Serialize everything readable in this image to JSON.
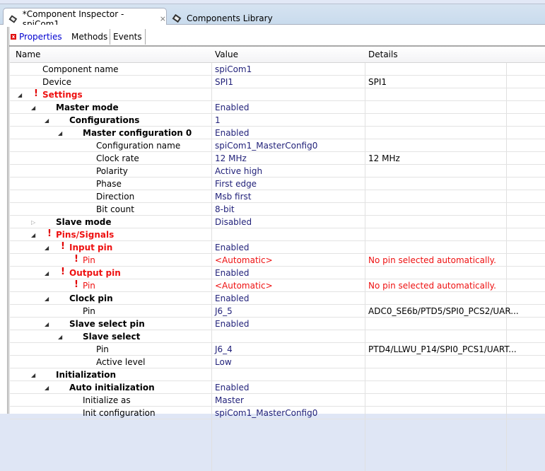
{
  "editor_tabs": [
    {
      "label": "*Component Inspector - spiCom1",
      "icon": "chip-icon",
      "active": true
    },
    {
      "label": "Components Library",
      "icon": "chip-icon",
      "active": false
    }
  ],
  "inspector_tabs": [
    {
      "label": "Properties",
      "active": true,
      "has_error": true
    },
    {
      "label": "Methods"
    },
    {
      "label": "Events"
    }
  ],
  "columns": [
    "Name",
    "Value",
    "Details"
  ],
  "colors": {
    "error": "#ee1111",
    "value": "#22227a",
    "tab_active_text": "#0000d0"
  },
  "rows": [
    {
      "name": "Component name",
      "value": "spiCom1",
      "details": "",
      "depth": 0
    },
    {
      "name": "Device",
      "value": "SPI1",
      "details": "SPI1",
      "depth": 0
    },
    {
      "name": "Settings",
      "value": "",
      "details": "",
      "depth": 0,
      "expand": "open",
      "error": true
    },
    {
      "name": "Master mode",
      "value": "Enabled",
      "details": "",
      "depth": 1,
      "expand": "open"
    },
    {
      "name": "Configurations",
      "value": "1",
      "details": "",
      "depth": 2,
      "expand": "open"
    },
    {
      "name": "Master configuration 0",
      "value": "Enabled",
      "details": "",
      "depth": 3,
      "expand": "open"
    },
    {
      "name": "Configuration name",
      "value": "spiCom1_MasterConfig0",
      "details": "",
      "depth": 4
    },
    {
      "name": "Clock rate",
      "value": "12 MHz",
      "details": "12 MHz",
      "depth": 4
    },
    {
      "name": "Polarity",
      "value": "Active high",
      "details": "",
      "depth": 4
    },
    {
      "name": "Phase",
      "value": "First edge",
      "details": "",
      "depth": 4
    },
    {
      "name": "Direction",
      "value": "Msb first",
      "details": "",
      "depth": 4
    },
    {
      "name": "Bit count",
      "value": "8-bit",
      "details": "",
      "depth": 4
    },
    {
      "name": "Slave mode",
      "value": "Disabled",
      "details": "",
      "depth": 1,
      "expand": "closed"
    },
    {
      "name": "Pins/Signals",
      "value": "",
      "details": "",
      "depth": 1,
      "expand": "open",
      "error": true
    },
    {
      "name": "Input pin",
      "value": "Enabled",
      "details": "",
      "depth": 2,
      "expand": "open",
      "error": true
    },
    {
      "name": "Pin",
      "value": "<Automatic>",
      "details": "No pin selected automatically.",
      "depth": 3,
      "error": true
    },
    {
      "name": "Output pin",
      "value": "Enabled",
      "details": "",
      "depth": 2,
      "expand": "open",
      "error": true
    },
    {
      "name": "Pin",
      "value": "<Automatic>",
      "details": "No pin selected automatically.",
      "depth": 3,
      "error": true
    },
    {
      "name": "Clock pin",
      "value": "Enabled",
      "details": "",
      "depth": 2,
      "expand": "open"
    },
    {
      "name": "Pin",
      "value": "J6_5",
      "details": "ADC0_SE6b/PTD5/SPI0_PCS2/UAR...",
      "depth": 3
    },
    {
      "name": "Slave select pin",
      "value": "Enabled",
      "details": "",
      "depth": 2,
      "expand": "open"
    },
    {
      "name": "Slave select",
      "value": "",
      "details": "",
      "depth": 3,
      "expand": "open"
    },
    {
      "name": "Pin",
      "value": "J6_4",
      "details": "PTD4/LLWU_P14/SPI0_PCS1/UART...",
      "depth": 4
    },
    {
      "name": "Active level",
      "value": "Low",
      "details": "",
      "depth": 4
    },
    {
      "name": "Initialization",
      "value": "",
      "details": "",
      "depth": 1,
      "expand": "open"
    },
    {
      "name": "Auto initialization",
      "value": "Enabled",
      "details": "",
      "depth": 2,
      "expand": "open"
    },
    {
      "name": "Initialize as",
      "value": "Master",
      "details": "",
      "depth": 3
    },
    {
      "name": "Init configuration",
      "value": "spiCom1_MasterConfig0",
      "details": "",
      "depth": 3
    }
  ]
}
